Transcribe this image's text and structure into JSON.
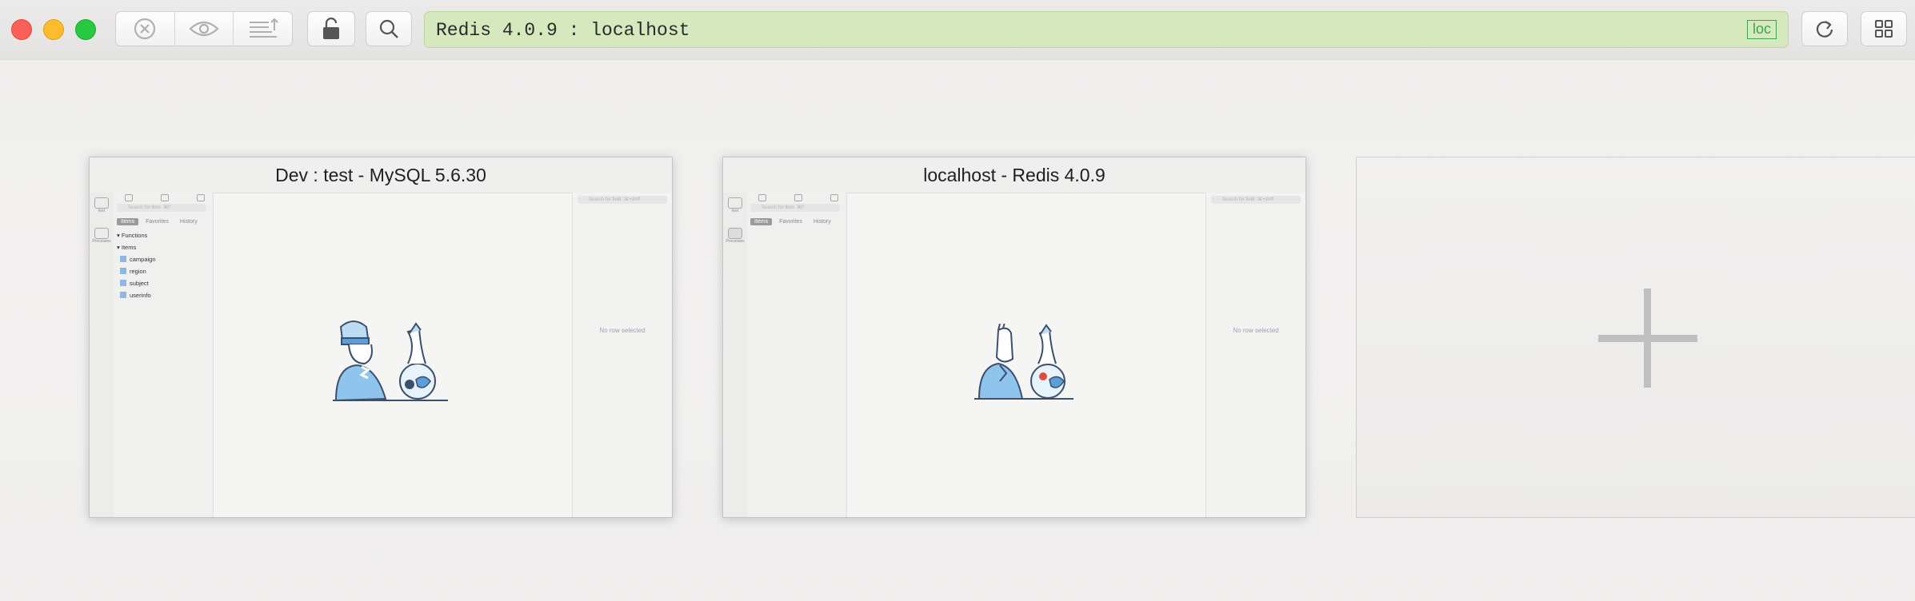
{
  "toolbar": {
    "address": "Redis 4.0.9 : localhost",
    "badge": "loc",
    "accent": "#d5e8be",
    "badge_color": "#3fa34d"
  },
  "cards": [
    {
      "title": "Dev : test - MySQL 5.6.30",
      "search_placeholder": "Search for item: ⌘F",
      "right_search_placeholder": "Search for field: ⌘+shift",
      "tabs": [
        "Items",
        "Favorites",
        "History"
      ],
      "tree": [
        "Functions",
        "Items",
        "campaign",
        "region",
        "subject",
        "userinfo"
      ],
      "status": "No row selected",
      "left_items": [
        "test",
        "Processes"
      ]
    },
    {
      "title": "localhost - Redis 4.0.9",
      "search_placeholder": "Search for item: ⌘F",
      "right_search_placeholder": "Search for field: ⌘+shift",
      "tabs": [
        "Items",
        "Favorites",
        "History"
      ],
      "status": "No row selected",
      "left_items": [
        "test",
        "Processes"
      ]
    }
  ],
  "icons": [
    "close-icon",
    "eye-icon",
    "list-upload-icon",
    "lock-icon",
    "search-icon",
    "refresh-icon",
    "grid-icon",
    "plus-icon"
  ]
}
